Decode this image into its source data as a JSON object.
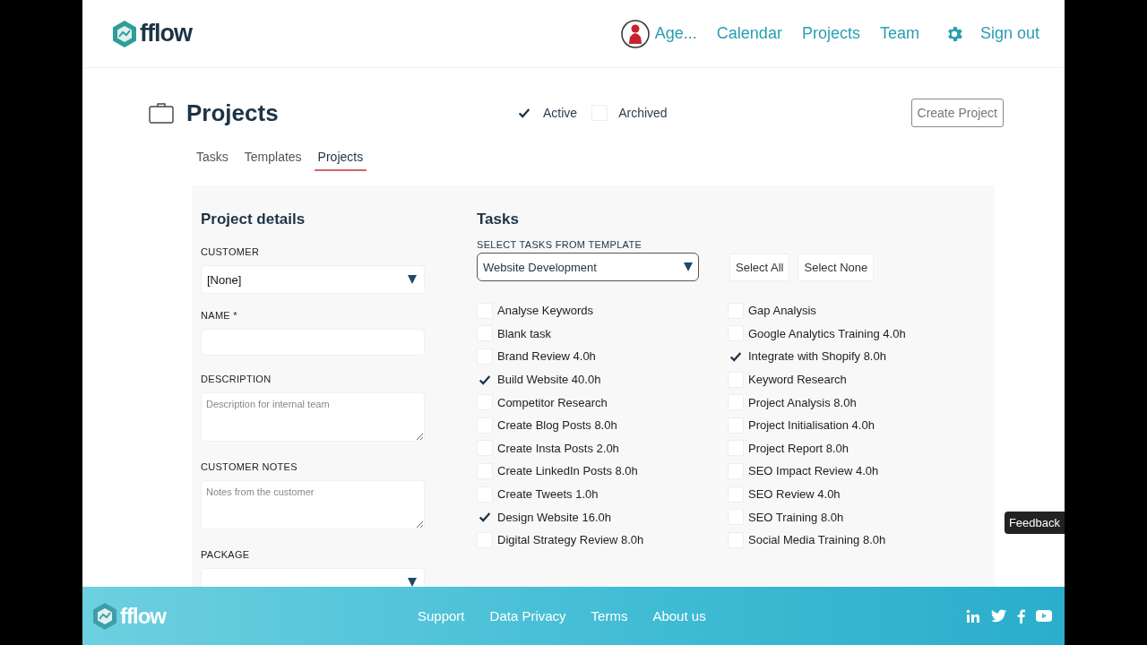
{
  "header": {
    "logo": "fflow",
    "user": "Age...",
    "nav": [
      {
        "label": "Calendar"
      },
      {
        "label": "Projects"
      },
      {
        "label": "Team"
      }
    ],
    "sign_out": "Sign out"
  },
  "page": {
    "title": "Projects",
    "filters": [
      {
        "label": "Active",
        "checked": true
      },
      {
        "label": "Archived",
        "checked": false
      }
    ],
    "create_button": "Create Project",
    "tabs": [
      {
        "label": "Tasks",
        "selected": false
      },
      {
        "label": "Templates",
        "selected": false
      },
      {
        "label": "Projects",
        "selected": true
      }
    ]
  },
  "details": {
    "heading": "Project details",
    "fields": [
      {
        "label": "CUSTOMER",
        "kind": "select",
        "value": "[None]"
      },
      {
        "label": "NAME *",
        "kind": "input"
      },
      {
        "label": "DESCRIPTION",
        "kind": "textarea",
        "placeholder": "Description for internal team"
      },
      {
        "label": "CUSTOMER NOTES",
        "kind": "textarea",
        "placeholder": "Notes from the customer"
      },
      {
        "label": "PACKAGE",
        "kind": "select"
      }
    ]
  },
  "tasks": {
    "heading": "Tasks",
    "template_label": "SELECT TASKS FROM TEMPLATE",
    "template": "Website Development",
    "buttons": [
      "Select All",
      "Select None"
    ],
    "columns": [
      {
        "items": [
          {
            "label": "Analyse Keywords",
            "checked": false
          },
          {
            "label": "Blank task",
            "checked": false
          },
          {
            "label": "Brand Review 4.0h",
            "checked": false
          },
          {
            "label": "Build Website 40.0h",
            "checked": true
          },
          {
            "label": "Competitor Research",
            "checked": false
          },
          {
            "label": "Create Blog Posts 8.0h",
            "checked": false
          },
          {
            "label": "Create Insta Posts 2.0h",
            "checked": false
          },
          {
            "label": "Create LinkedIn Posts 8.0h",
            "checked": false
          },
          {
            "label": "Create Tweets 1.0h",
            "checked": false
          },
          {
            "label": "Design Website 16.0h",
            "checked": true
          },
          {
            "label": "Digital Strategy Review 8.0h",
            "checked": false
          }
        ]
      },
      {
        "items": [
          {
            "label": "Gap Analysis",
            "checked": false
          },
          {
            "label": "Google Analytics Training 4.0h",
            "checked": false
          },
          {
            "label": "Integrate with Shopify 8.0h",
            "checked": true
          },
          {
            "label": "Keyword Research",
            "checked": false
          },
          {
            "label": "Project Analysis 8.0h",
            "checked": false
          },
          {
            "label": "Project Initialisation 4.0h",
            "checked": false
          },
          {
            "label": "Project Report 8.0h",
            "checked": false
          },
          {
            "label": "SEO Impact Review 4.0h",
            "checked": false
          },
          {
            "label": "SEO Review 4.0h",
            "checked": false
          },
          {
            "label": "SEO Training 8.0h",
            "checked": false
          },
          {
            "label": "Social Media Training 8.0h",
            "checked": false
          }
        ]
      }
    ]
  },
  "feedback": "Feedback",
  "footer": {
    "logo": "fflow",
    "links": [
      "Support",
      "Data Privacy",
      "Terms",
      "About us"
    ]
  }
}
